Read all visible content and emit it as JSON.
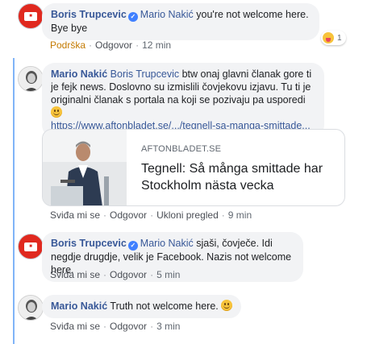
{
  "comment1": {
    "author": "Boris Trupcevic",
    "mention": "Mario Nakić",
    "text": "you're not welcome here. Bye bye",
    "action_support": "Podrška",
    "action_reply": "Odgovor",
    "time": "12 min",
    "reaction_count": "1"
  },
  "comment2": {
    "author": "Mario Nakić",
    "mention": "Boris Trupcevic",
    "text": "btw onaj glavni članak gore ti je fejk news. Doslovno su izmislili čovjekovu izjavu. Tu ti je originalni članak s portala na koji se pozivaju pa usporedi",
    "link_text": "https://www.aftonbladet.se/.../tegnell-sa-manga-smittade...",
    "card_domain": "AFTONBLADET.SE",
    "card_title": "Tegnell: Så många smittade har Stockholm nästa vecka",
    "action_like": "Sviđa mi se",
    "action_reply": "Odgovor",
    "action_remove_preview": "Ukloni pregled",
    "time": "9 min"
  },
  "comment3": {
    "author": "Boris Trupcevic",
    "mention": "Mario Nakić",
    "text": "sjaši, čovječe. Idi negdje drugdje, velik je Facebook. Nazis not welcome here.",
    "action_like": "Sviđa mi se",
    "action_reply": "Odgovor",
    "time": "5 min"
  },
  "comment4": {
    "author": "Mario Nakić",
    "text": "Truth not welcome here.",
    "action_like": "Sviđa mi se",
    "action_reply": "Odgovor",
    "time": "3 min"
  },
  "icons": {
    "verified": "verified-badge-icon",
    "smile": "smile-emoji-icon",
    "haha": "haha-reaction-icon"
  },
  "colors": {
    "link_blue": "#385898",
    "thread_line": "#1877f2",
    "bubble_bg": "#f2f3f5",
    "support_orange": "#c47a00"
  }
}
